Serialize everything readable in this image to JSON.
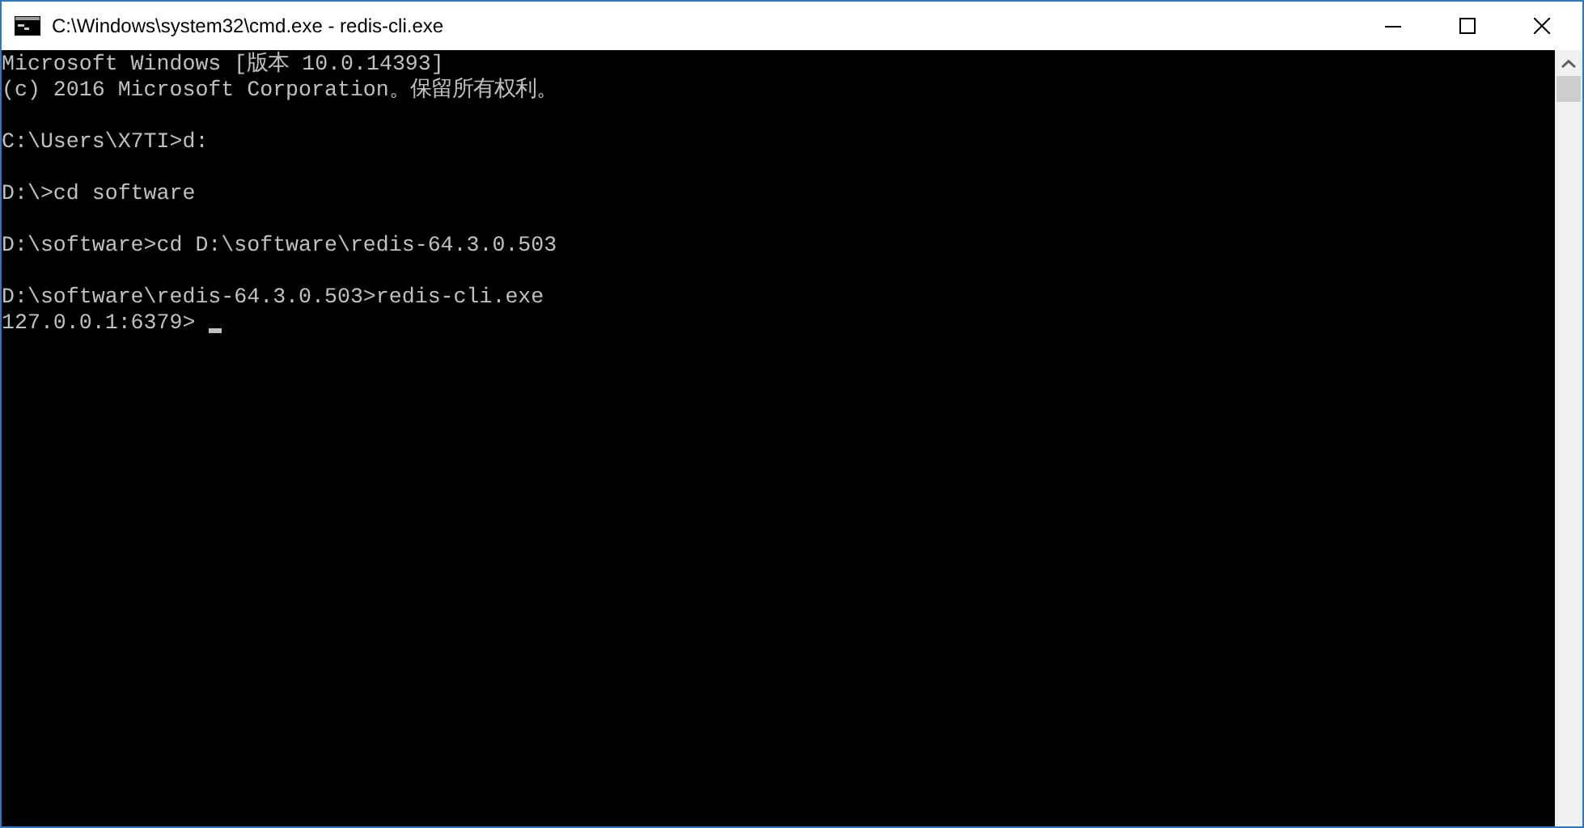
{
  "window": {
    "title": "C:\\Windows\\system32\\cmd.exe - redis-cli.exe"
  },
  "console": {
    "blocks": [
      [
        "Microsoft Windows [版本 10.0.14393]",
        "(c) 2016 Microsoft Corporation。保留所有权利。"
      ],
      [
        "C:\\Users\\X7TI>d:"
      ],
      [
        "D:\\>cd software"
      ],
      [
        "D:\\software>cd D:\\software\\redis-64.3.0.503"
      ],
      [
        "D:\\software\\redis-64.3.0.503>redis-cli.exe",
        "127.0.0.1:6379>"
      ]
    ],
    "cursor": true
  }
}
